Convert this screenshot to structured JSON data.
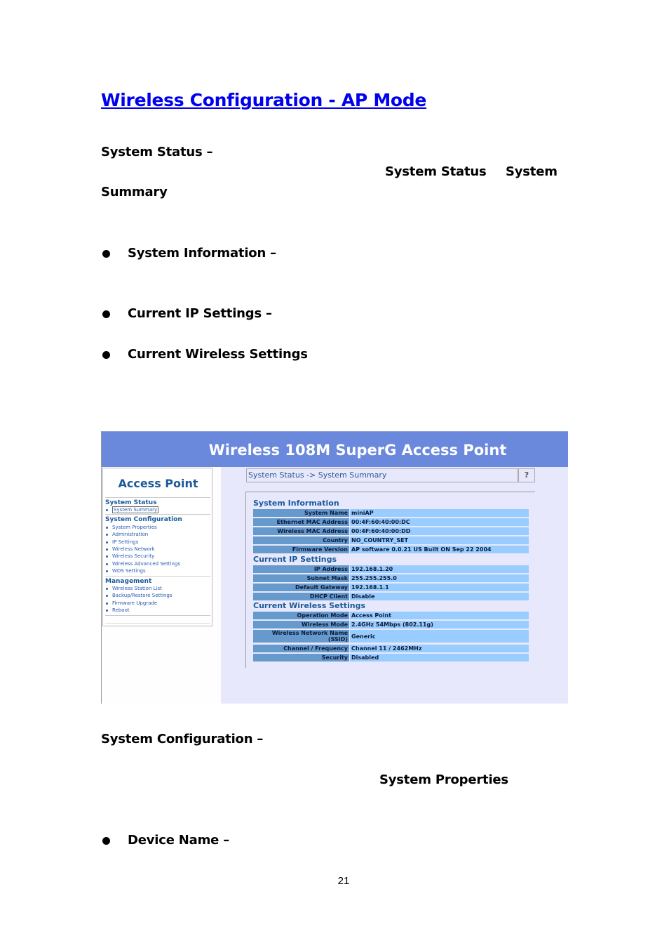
{
  "document": {
    "title": "Wireless Configuration - AP Mode",
    "system_status_heading": "System Status –",
    "system_status_ref1": "System Status",
    "system_status_ref2": "System",
    "system_status_ref3": "Summary",
    "bullets_status": [
      "System Information –",
      "Current IP Settings –",
      "Current Wireless Settings"
    ],
    "system_config_heading": "System Configuration –",
    "system_properties_ref": "System Properties",
    "bullets_config": [
      "Device Name –"
    ],
    "page_number": "21"
  },
  "screenshot": {
    "header_title": "Wireless 108M SuperG Access Point",
    "sidebar": {
      "title": "Access Point",
      "groups": [
        {
          "heading": "System Status",
          "items": [
            "System Summary"
          ]
        },
        {
          "heading": "System Configuration",
          "items": [
            "System Properties",
            "Administration",
            "IP Settings",
            "Wireless Network",
            "Wireless Security",
            "Wireless Advanced Settings",
            "WDS Settings"
          ]
        },
        {
          "heading": "Management",
          "items": [
            "Wireless Station List",
            "Backup/Restore Settings",
            "Firmware Upgrade",
            "Reboot"
          ]
        }
      ],
      "active_item": "System Summary"
    },
    "breadcrumb": "System Status -> System Summary",
    "help_label": "?",
    "sections": [
      {
        "heading": "System Information",
        "rows": [
          {
            "label": "System Name",
            "value": "miniAP"
          },
          {
            "label": "Ethernet MAC Address",
            "value": "00:4F:60:40:00:DC"
          },
          {
            "label": "Wireless MAC Address",
            "value": "00:4F:60:40:00:DD"
          },
          {
            "label": "Country",
            "value": "NO_COUNTRY_SET"
          },
          {
            "label": "Firmware Version",
            "value": "AP software 0.0.21 US Built ON Sep 22 2004"
          }
        ]
      },
      {
        "heading": "Current IP Settings",
        "rows": [
          {
            "label": "IP Address",
            "value": "192.168.1.20"
          },
          {
            "label": "Subnet Mask",
            "value": "255.255.255.0"
          },
          {
            "label": "Default Gateway",
            "value": "192.168.1.1"
          },
          {
            "label": "DHCP Client",
            "value": "Disable"
          }
        ]
      },
      {
        "heading": "Current Wireless Settings",
        "rows": [
          {
            "label": "Operation Mode",
            "value": "Access Point"
          },
          {
            "label": "Wireless Mode",
            "value": "2.4GHz 54Mbps (802.11g)"
          },
          {
            "label": "Wireless Network Name (SSID)",
            "value": "Generic"
          },
          {
            "label": "Channel / Frequency",
            "value": "Channel 11 / 2462MHz"
          },
          {
            "label": "Security",
            "value": "Disabled"
          }
        ]
      }
    ],
    "colors": {
      "header_bg": "#6a88dc",
      "content_bg": "#e8e8fc",
      "label_cell": "#6699cc",
      "value_cell": "#99ccff",
      "heading_text": "#1a5a9a"
    }
  }
}
